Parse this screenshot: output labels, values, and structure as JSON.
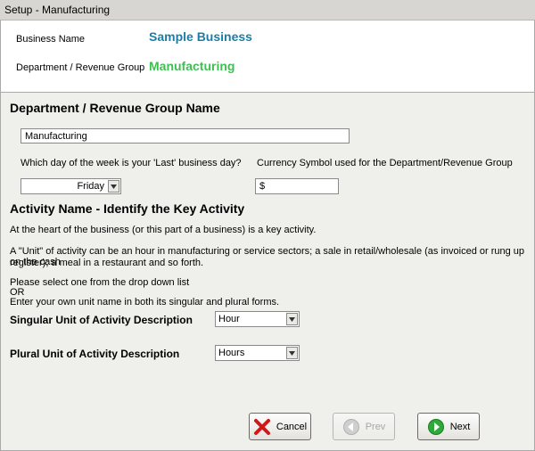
{
  "window": {
    "title": "Setup - Manufacturing"
  },
  "header": {
    "business_label": "Business Name",
    "business_value": "Sample Business",
    "department_label": "Department / Revenue Group",
    "department_value": "Manufacturing",
    "colors": {
      "business": "#1c7ea8",
      "department": "#3fbf52"
    }
  },
  "form": {
    "section1_title": "Department / Revenue Group Name",
    "dept_name_value": "Manufacturing",
    "last_day_label": "Which day of the week is your 'Last' business day?",
    "last_day_value": "Friday",
    "currency_label": "Currency Symbol used for the Department/Revenue Group",
    "currency_value": "$",
    "section2_title": "Activity Name - Identify the Key Activity",
    "intro_text": "At the heart of the business (or this part of a business) is a key activity.",
    "unit_text_line1": "A \"Unit\" of activity can be an hour in manufacturing or service sectors; a sale in retail/wholesale (as invoiced or rung up on the cash",
    "unit_text_line2": "register); a meal in a restaurant and so forth.",
    "instruction_line1": "Please select one from the drop down list",
    "instruction_line2": "OR",
    "instruction_line3": "Enter your own unit name in both its singular and plural forms.",
    "singular_label": "Singular Unit of Activity Description",
    "singular_value": "Hour",
    "plural_label": "Plural Unit of Activity Description",
    "plural_value": "Hours"
  },
  "buttons": {
    "cancel_label": "Cancel",
    "prev_label": "Prev",
    "next_label": "Next",
    "icons": {
      "cancel": "red-x-icon",
      "prev": "left-arrow-icon",
      "next": "green-right-arrow-icon"
    }
  }
}
